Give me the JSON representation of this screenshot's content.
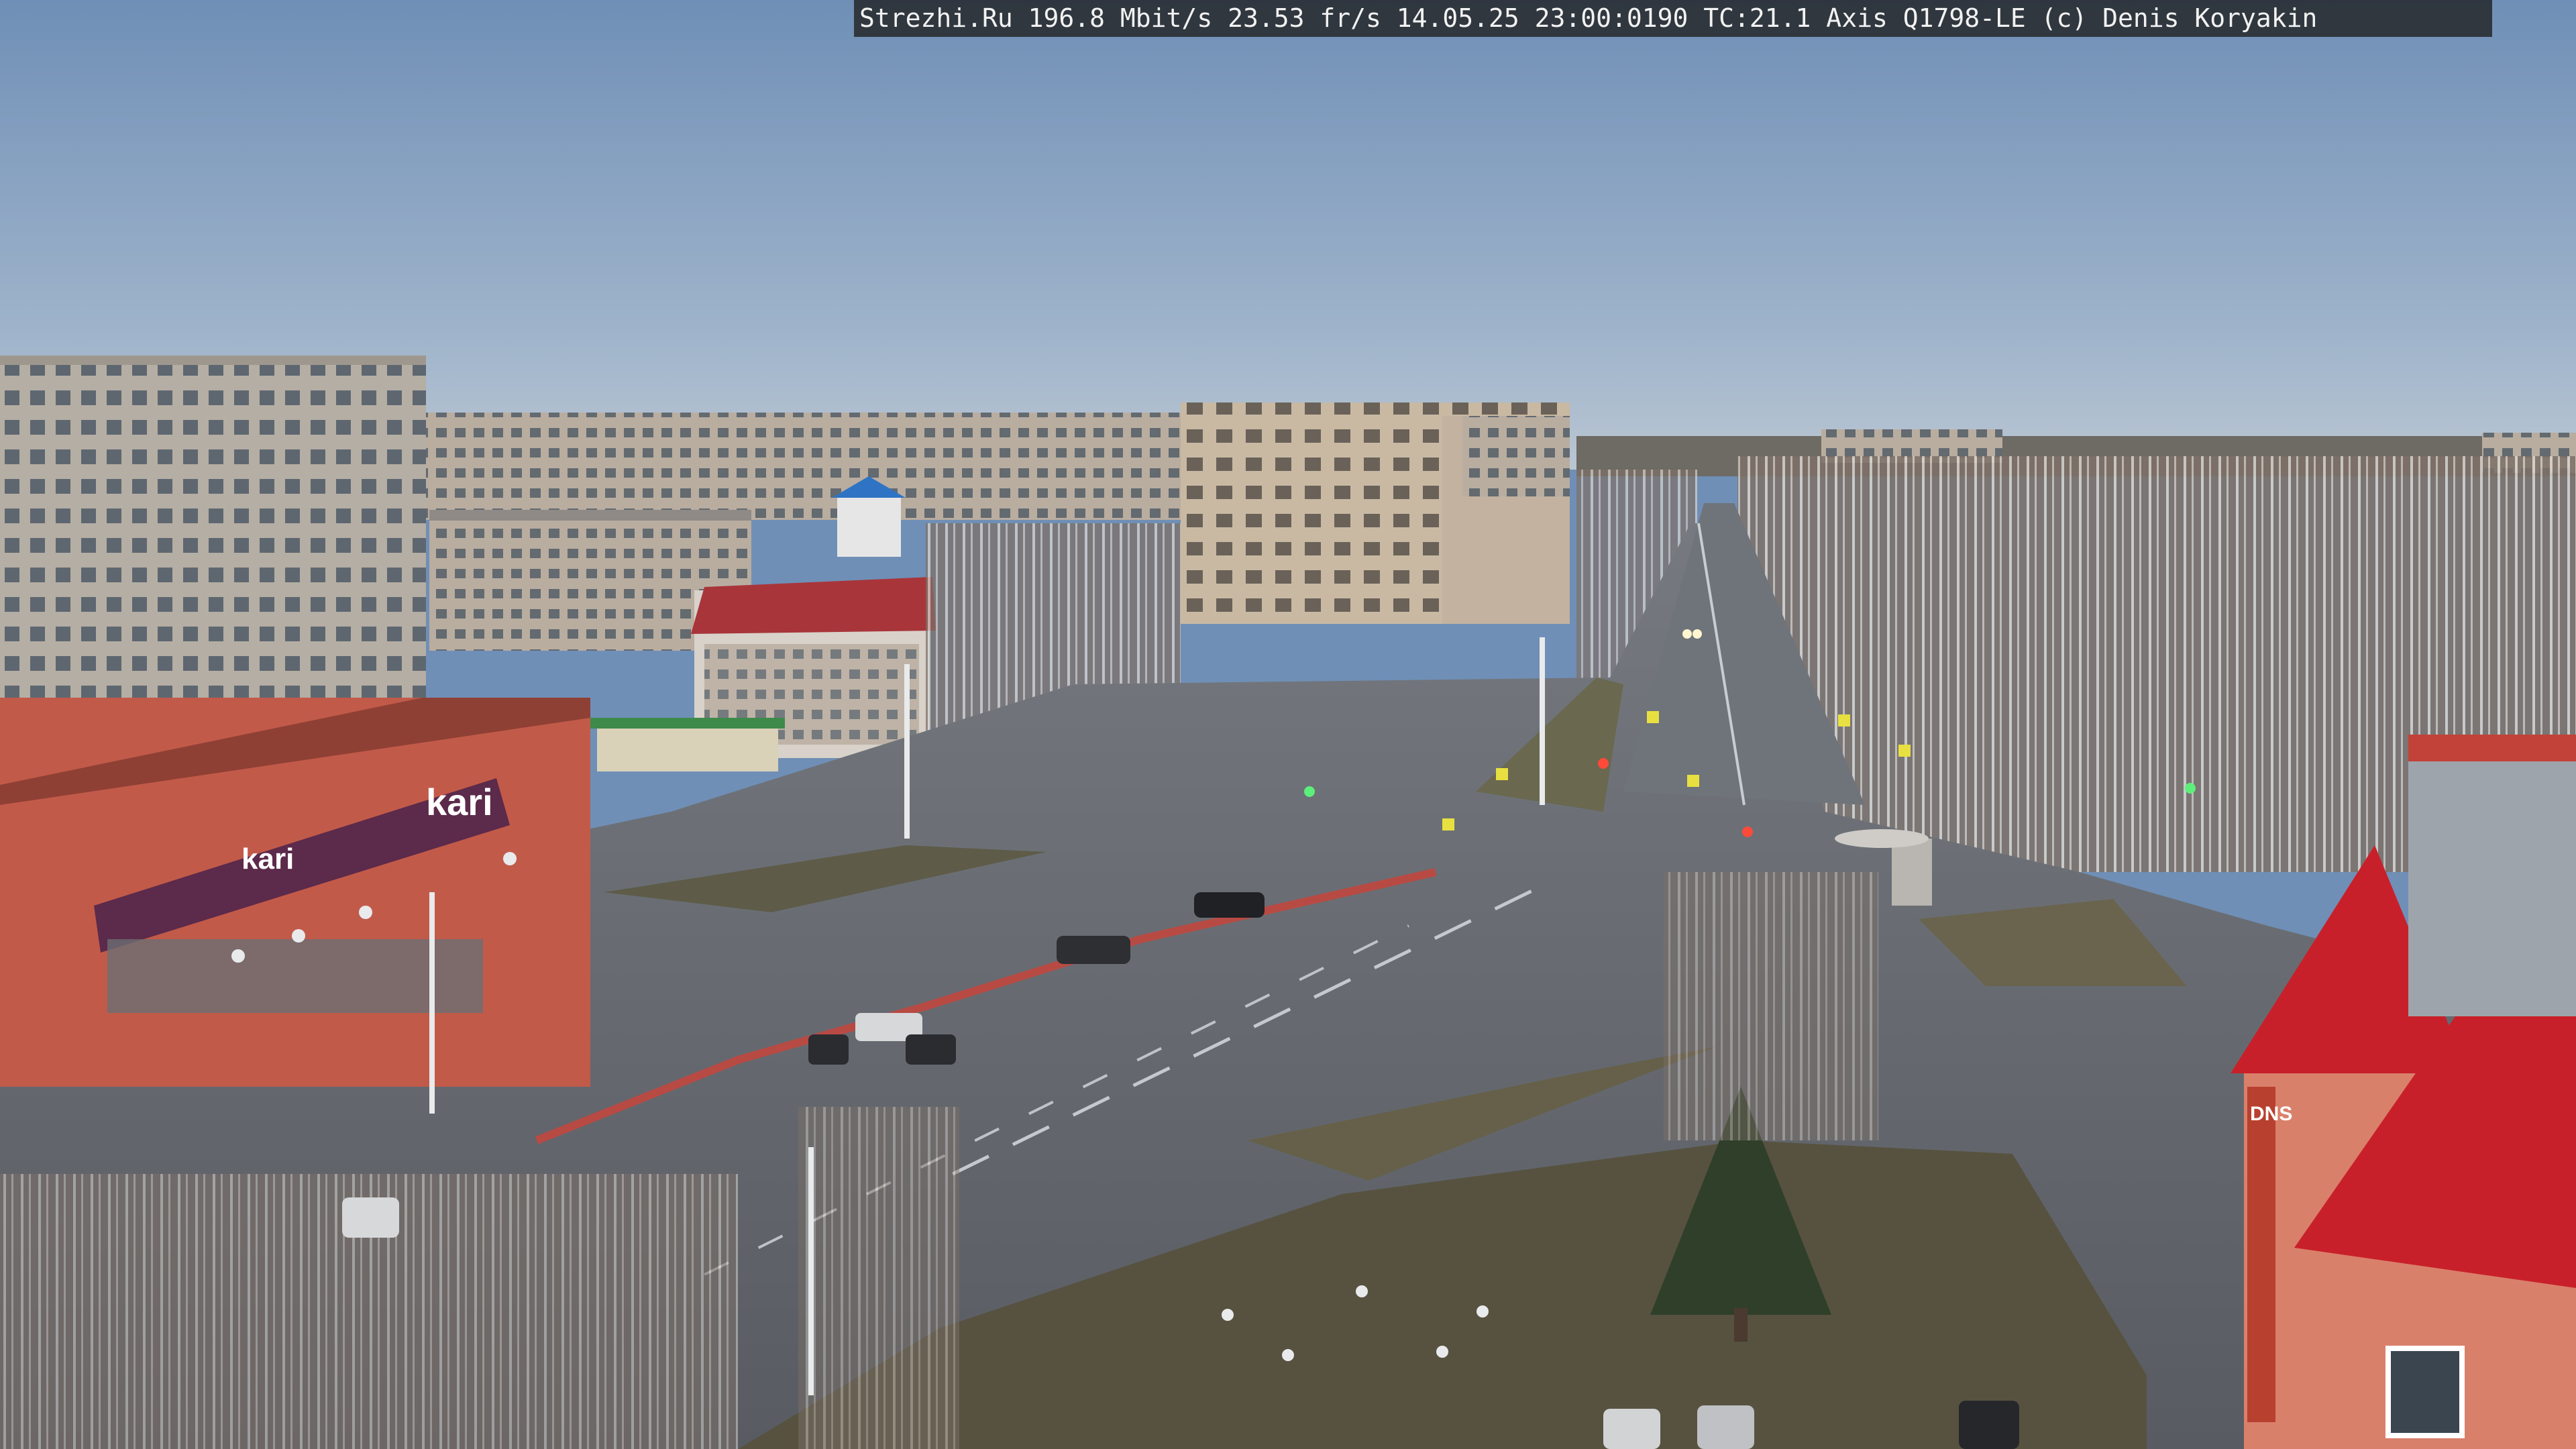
{
  "camera": {
    "overlay_text": "Strezhi.Ru 196.8 Mbit/s 23.53 fr/s 14.05.25 23:00:0190 TC:21.1  Axis Q1798-LE  (c) Denis Koryakin"
  },
  "signs": {
    "store_kari_large": "kari",
    "store_kari_small": "kari",
    "store_dns": "DNS"
  },
  "colors": {
    "sky_top": "#6f8fb6",
    "sky_horizon": "#b3c3d3",
    "road": "#5b5f66",
    "grass": "#5d5a45",
    "brick_red": "#c25a4a",
    "roof_red": "#c8202a",
    "panel_building": "#b8b1a8",
    "tree_bare": "#8a7d72",
    "signage_purple": "#5c2a4a"
  }
}
